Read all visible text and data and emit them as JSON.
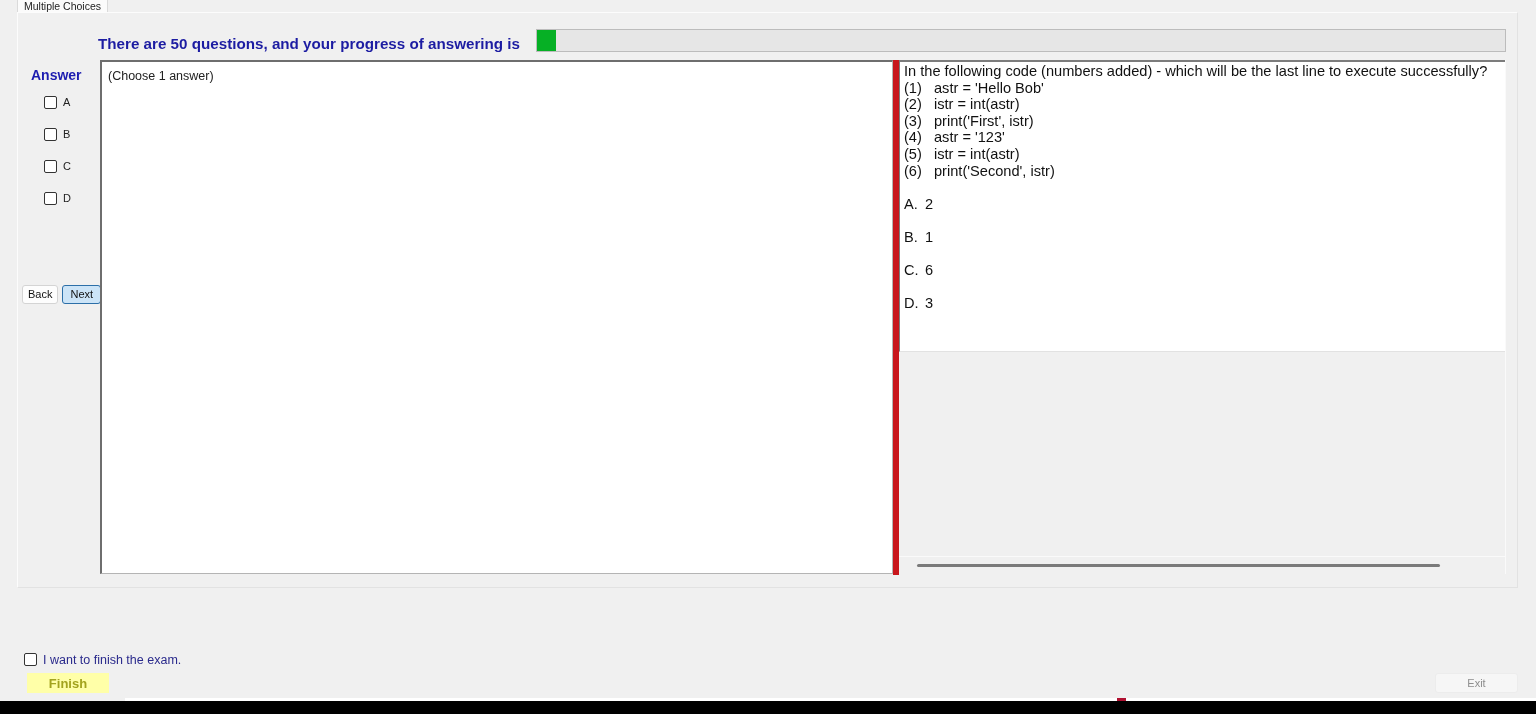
{
  "tab": {
    "label": "Multiple Choices",
    "selected": true
  },
  "header": {
    "text": "There are 50 questions, and your progress of answering is",
    "progress": {
      "level": 0.02
    }
  },
  "answer_panel": {
    "title": "Answer",
    "options": [
      {
        "label": "A",
        "checked": false
      },
      {
        "label": "B",
        "checked": false
      },
      {
        "label": "C",
        "checked": false
      },
      {
        "label": "D",
        "checked": false
      }
    ],
    "buttons": [
      {
        "label": "Back",
        "focused": false
      },
      {
        "label": "Next",
        "focused": true
      }
    ]
  },
  "answer_box": {
    "text": "(Choose 1 answer)"
  },
  "question": {
    "prompt": "In the following code (numbers added) - which will be the last line to execute successfully?",
    "code_lines": [
      {
        "number": "(1)",
        "code": "astr = 'Hello Bob'"
      },
      {
        "number": "(2)",
        "code": "istr = int(astr)"
      },
      {
        "number": "(3)",
        "code": "print('First', istr)"
      },
      {
        "number": "(4)",
        "code": "astr = '123'"
      },
      {
        "number": "(5)",
        "code": "istr = int(astr)"
      },
      {
        "number": "(6)",
        "code": "print('Second', istr)"
      }
    ],
    "choices": [
      {
        "letter": "A.",
        "value": "2"
      },
      {
        "letter": "B.",
        "value": "1"
      },
      {
        "letter": "C.",
        "value": "6"
      },
      {
        "letter": "D.",
        "value": "3"
      }
    ]
  },
  "finish": {
    "confirm": {
      "label": "I want to finish the exam.",
      "checked": false
    },
    "finish_button": "Finish",
    "exit_button": {
      "label": "Exit",
      "disabled": true
    }
  }
}
